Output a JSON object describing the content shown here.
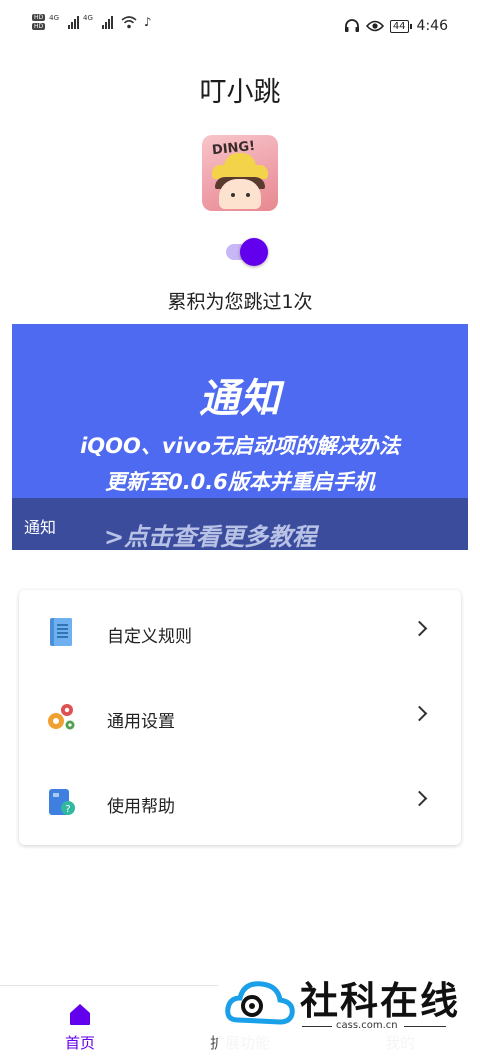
{
  "status_bar": {
    "network_1": "4G",
    "network_2": "4G",
    "battery": "44",
    "time": "4:46"
  },
  "header": {
    "title": "叮小跳"
  },
  "app_icon": {
    "text": "DING!"
  },
  "skip_toggle": {
    "on": true
  },
  "counter_text": "累积为您跳过1次",
  "notice_banner": {
    "title": "通知",
    "line1": "iQOO、vivo无启动项的解决办法",
    "line2": "更新至0.0.6版本并重启手机",
    "label": "通知",
    "more": ">点击查看更多教程"
  },
  "menu": {
    "items": [
      {
        "label": "自定义规则",
        "icon": "rules-document-icon"
      },
      {
        "label": "通用设置",
        "icon": "gears-icon"
      },
      {
        "label": "使用帮助",
        "icon": "help-book-icon"
      }
    ]
  },
  "bottom_nav": {
    "items": [
      {
        "label": "首页",
        "active": true
      },
      {
        "label": "扩展功能",
        "active": false
      },
      {
        "label": "我的",
        "active": false
      }
    ]
  },
  "watermark": {
    "text": "社科在线",
    "url": "cass.com.cn"
  },
  "colors": {
    "accent": "#6200ee",
    "banner_bg": "#4e6af0",
    "banner_strip": "#3b4c9c"
  }
}
